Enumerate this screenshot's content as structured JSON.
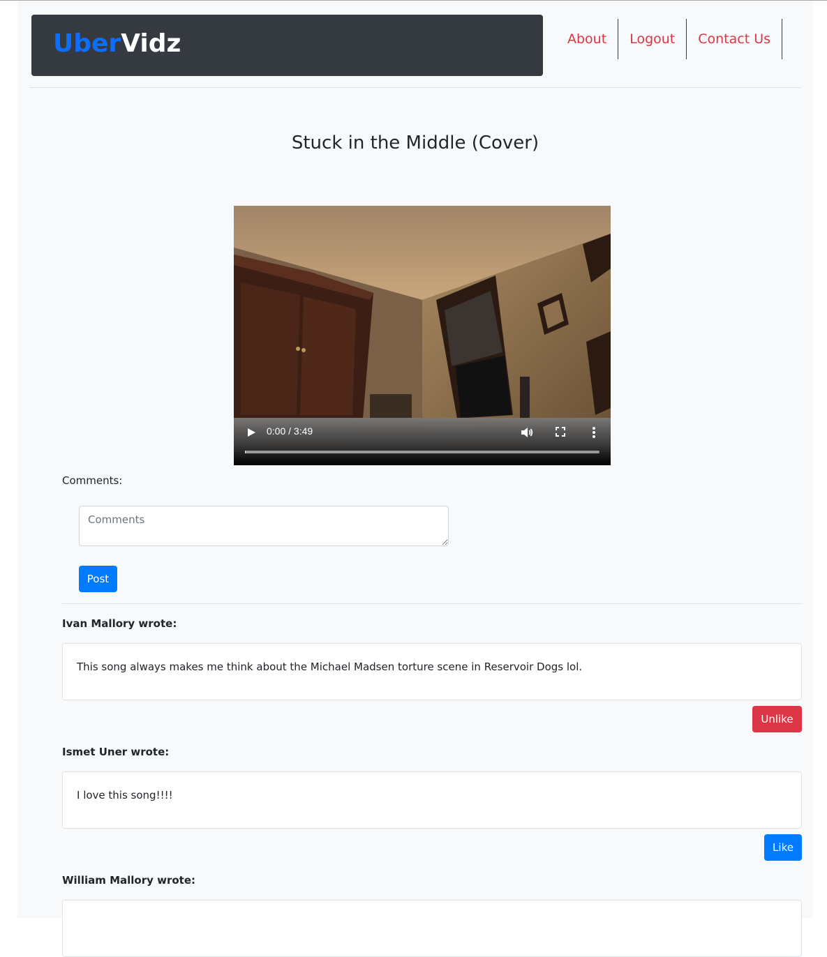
{
  "brand": {
    "part1": "Uber",
    "part2": "Vidz"
  },
  "nav": {
    "about": "About",
    "logout": "Logout",
    "contact": "Contact Us"
  },
  "video": {
    "title": "Stuck in the Middle (Cover)",
    "time": "0:00 / 3:49",
    "progress": 0
  },
  "form": {
    "label": "Comments:",
    "placeholder": "Comments",
    "post_label": "Post"
  },
  "comments": [
    {
      "author": "Ivan Mallory wrote:",
      "text": "This song always makes me think about the Michael Madsen torture scene in Reservoir Dogs lol.",
      "action": "Unlike"
    },
    {
      "author": "Ismet Uner wrote:",
      "text": "I love this song!!!!",
      "action": "Like"
    },
    {
      "author": "William Mallory wrote:",
      "text": "",
      "action": ""
    }
  ],
  "colors": {
    "brand_blue": "#0d6efd",
    "nav_red": "#dc3545",
    "primary": "#007bff",
    "danger": "#dc3545",
    "header_dark": "#343a40"
  }
}
